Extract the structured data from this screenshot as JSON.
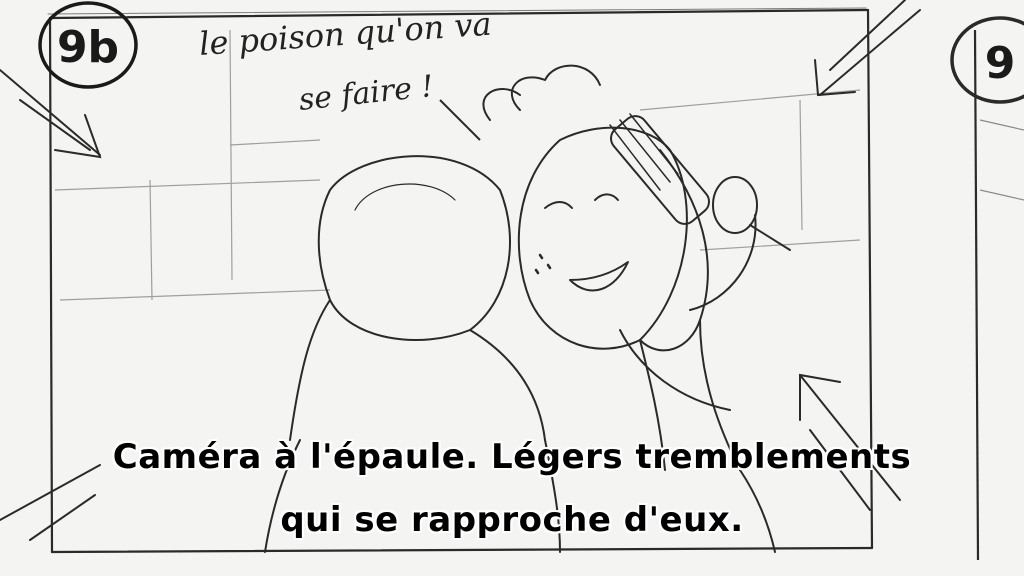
{
  "panel_number": "9b",
  "next_panel_number_partial": "9",
  "handwritten_note": {
    "line1": "le poison qu'on va",
    "line2": "se faire !"
  },
  "caption": {
    "line1": "Caméra à l'épaule. Légers tremblements",
    "line2": "qui se rapproche d'eux."
  },
  "colors": {
    "paper": "#f4f4f2",
    "pencil": "#2a2a2a",
    "caption_text": "#000000"
  }
}
